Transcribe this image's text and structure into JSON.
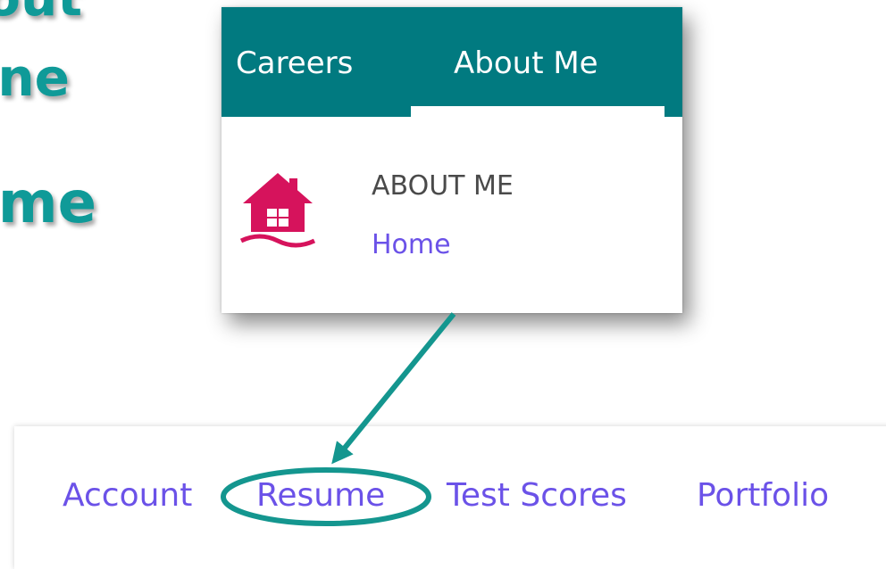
{
  "background_heading": {
    "line1": "out",
    "line2": "ne",
    "line3": "me"
  },
  "menu": {
    "tabs": [
      {
        "label": "Careers"
      },
      {
        "label": "About Me"
      }
    ],
    "section_title": "ABOUT ME",
    "section_link": "Home"
  },
  "nav": {
    "links": [
      {
        "label": "Account"
      },
      {
        "label": "Resume"
      },
      {
        "label": "Test Scores"
      },
      {
        "label": "Portfolio"
      }
    ]
  },
  "icons": {
    "home": "house-icon"
  },
  "colors": {
    "teal_bar": "#017a80",
    "teal_heading": "#0f9a98",
    "link": "#6b52e8",
    "icon": "#d6135c",
    "annotation": "#14968f"
  }
}
